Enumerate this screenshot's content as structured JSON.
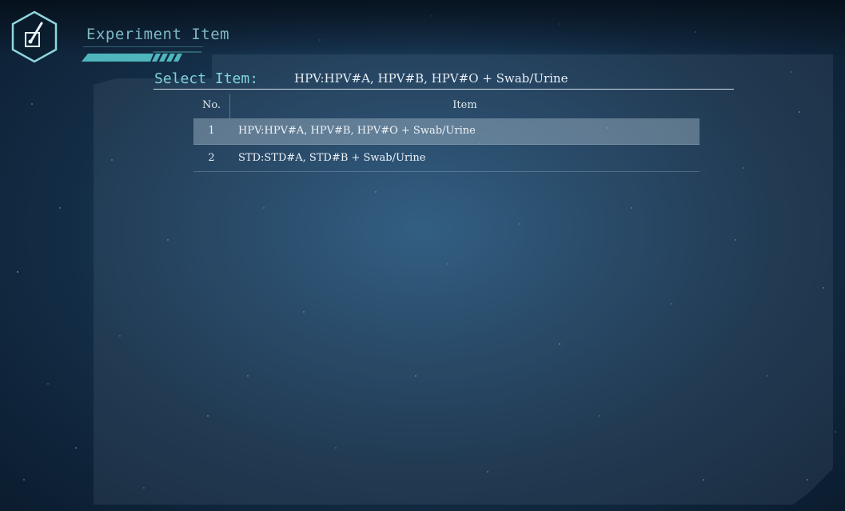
{
  "header": {
    "title": "Experiment Item",
    "icon": "experiment-pipette-icon"
  },
  "selection": {
    "label": "Select Item:",
    "value": "HPV:HPV#A, HPV#B, HPV#O + Swab/Urine"
  },
  "table": {
    "columns": [
      "No.",
      "Item"
    ],
    "rows": [
      {
        "no": "1",
        "item": "HPV:HPV#A, HPV#B, HPV#O + Swab/Urine",
        "selected": true
      },
      {
        "no": "2",
        "item": "STD:STD#A, STD#B + Swab/Urine",
        "selected": false
      }
    ]
  },
  "colors": {
    "accent": "#7fd3db",
    "title": "#7fb9c2",
    "stripe": "#4fb6bd",
    "selected_row": "#8fa4b4"
  }
}
